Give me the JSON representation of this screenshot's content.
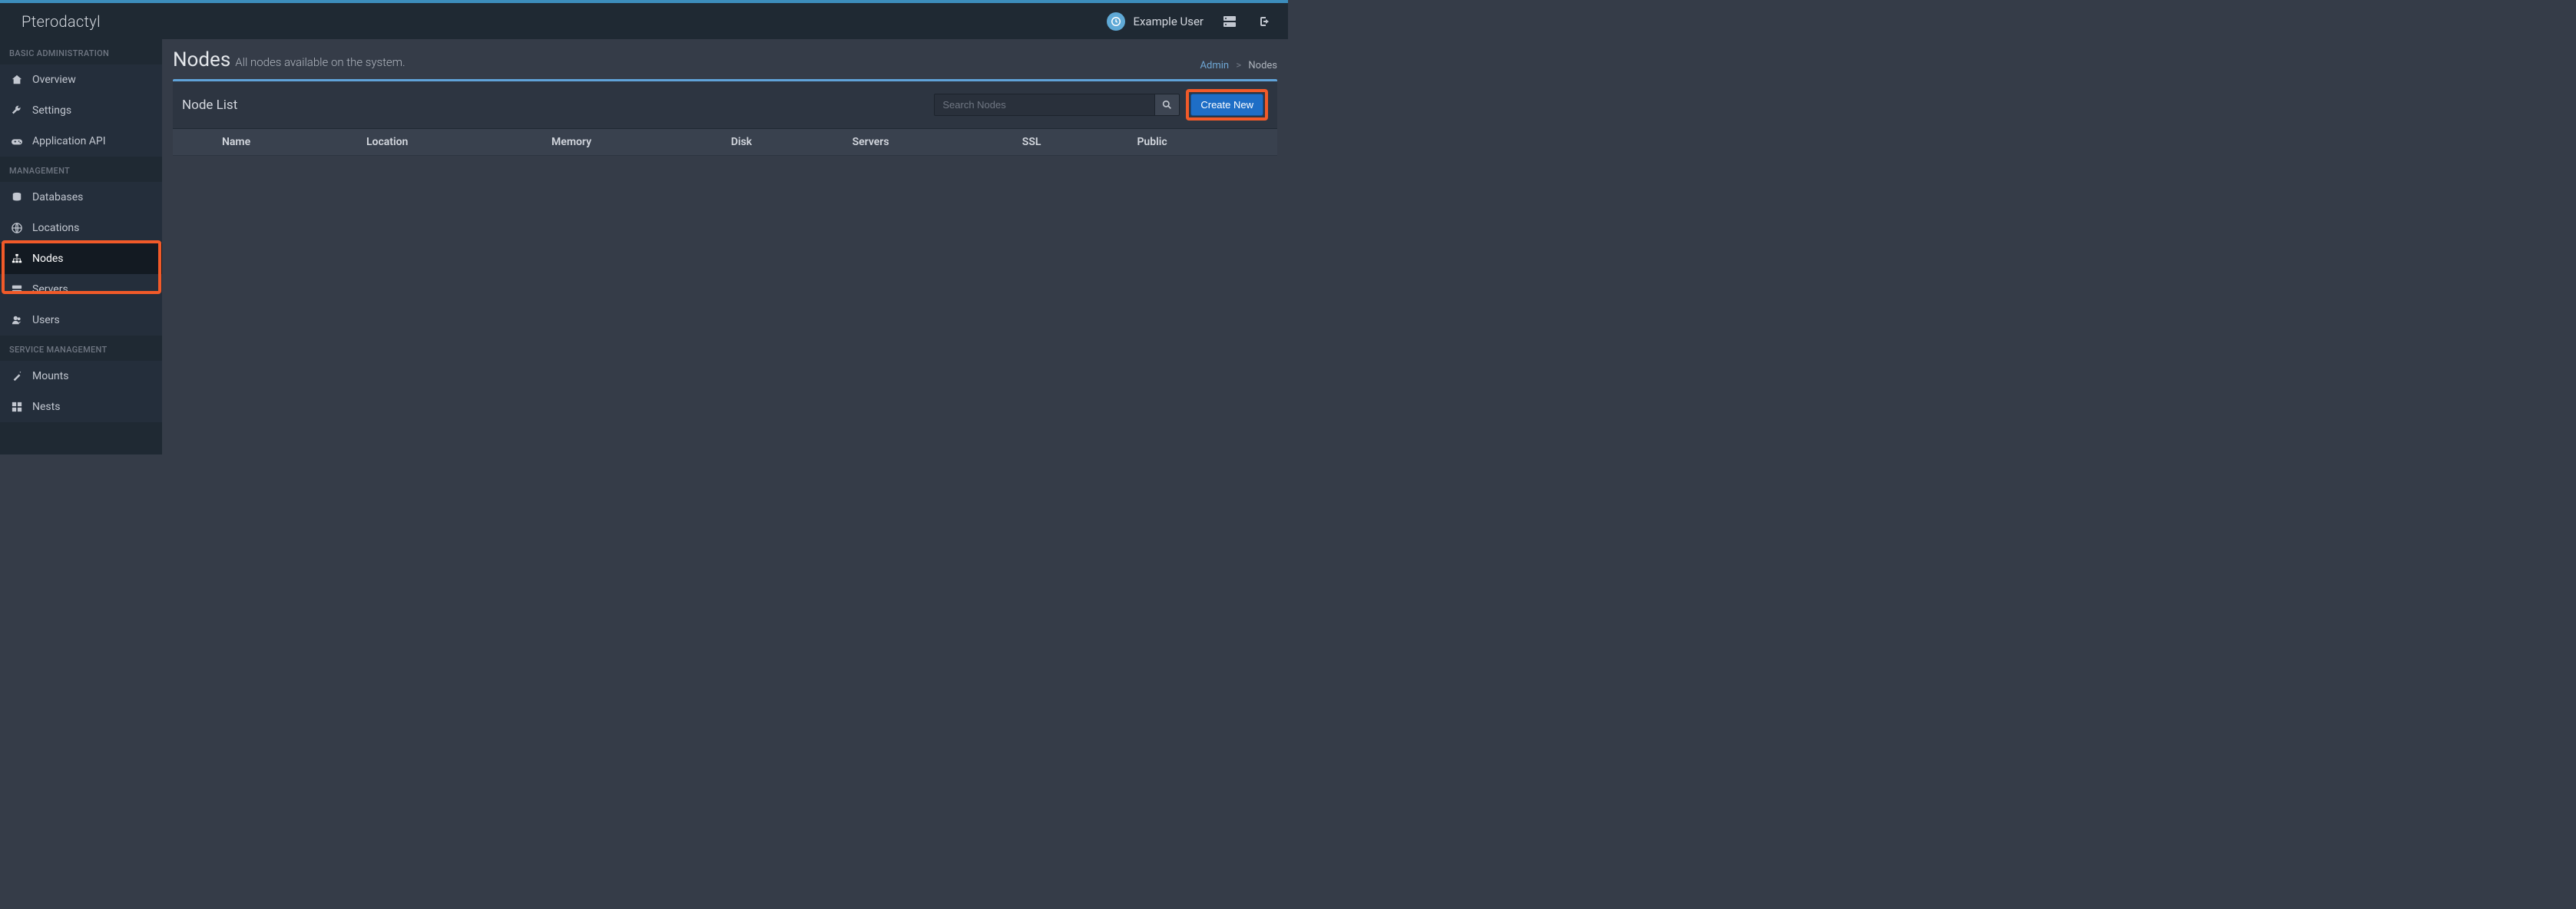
{
  "brand": "Pterodactyl",
  "user": {
    "name": "Example User"
  },
  "sidebar": {
    "sections": {
      "basic": "BASIC ADMINISTRATION",
      "mgmt": "MANAGEMENT",
      "svc": "SERVICE MANAGEMENT"
    },
    "items": {
      "overview": "Overview",
      "settings": "Settings",
      "api": "Application API",
      "databases": "Databases",
      "locations": "Locations",
      "nodes": "Nodes",
      "servers": "Servers",
      "users": "Users",
      "mounts": "Mounts",
      "nests": "Nests"
    }
  },
  "page": {
    "title": "Nodes",
    "subtitle": "All nodes available on the system.",
    "breadcrumb": {
      "admin": "Admin",
      "current": "Nodes"
    }
  },
  "panel": {
    "title": "Node List",
    "searchPlaceholder": "Search Nodes",
    "createLabel": "Create New",
    "columns": {
      "name": "Name",
      "location": "Location",
      "memory": "Memory",
      "disk": "Disk",
      "servers": "Servers",
      "ssl": "SSL",
      "public": "Public"
    }
  }
}
